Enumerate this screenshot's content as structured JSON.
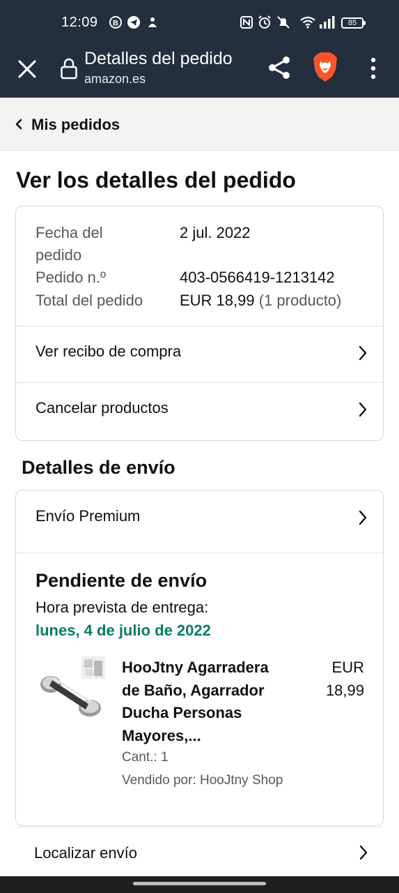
{
  "status_bar": {
    "time": "12:09",
    "battery": "85",
    "left_icons": [
      "b-circle-icon",
      "telegram-icon",
      "notification-icon"
    ],
    "right_icons": [
      "nfc-icon",
      "alarm-icon",
      "mute-icon",
      "wifi-icon",
      "signal-icon"
    ]
  },
  "browser": {
    "title": "Detalles del pedido",
    "domain": "amazon.es",
    "accent": "#fb542b"
  },
  "breadcrumb": {
    "label": "Mis pedidos"
  },
  "page_heading": "Ver los detalles del pedido",
  "order": {
    "date_label_line1": "Fecha del",
    "date_label_line2": "pedido",
    "date_value": "2 jul. 2022",
    "number_label": "Pedido n.º",
    "number_value": "403-0566419-1213142",
    "total_label": "Total del pedido",
    "total_value": "EUR 18,99",
    "total_count": "(1 producto)",
    "receipt_link": "Ver recibo de compra",
    "cancel_link": "Cancelar productos"
  },
  "shipping": {
    "heading": "Detalles de envío",
    "method": "Envío Premium",
    "status": "Pendiente de envío",
    "eta_label": "Hora prevista de entrega:",
    "eta_date": "lunes, 4 de julio de 2022",
    "eta_color": "#067d62",
    "product": {
      "title_line1": "HooJtny Agarradera",
      "title_line2": "de Baño, Agarrador",
      "title_line3": "Ducha Personas",
      "title_line4": "Mayores,...",
      "price_currency": "EUR",
      "price_amount": "18,99",
      "quantity": "Cant.: 1",
      "seller": "Vendido por: HooJtny Shop"
    },
    "track_link": "Localizar envío"
  }
}
